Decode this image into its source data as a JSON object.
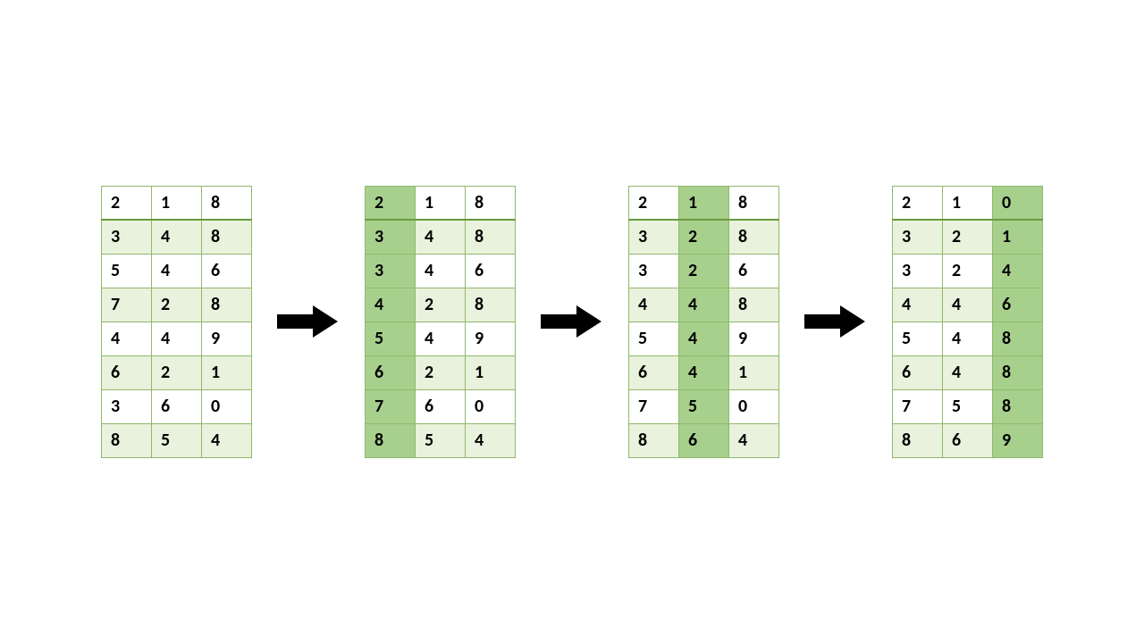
{
  "tables": [
    {
      "highlightCol": null,
      "rows": [
        [
          2,
          1,
          8
        ],
        [
          3,
          4,
          8
        ],
        [
          5,
          4,
          6
        ],
        [
          7,
          2,
          8
        ],
        [
          4,
          4,
          9
        ],
        [
          6,
          2,
          1
        ],
        [
          3,
          6,
          0
        ],
        [
          8,
          5,
          4
        ]
      ]
    },
    {
      "highlightCol": 0,
      "rows": [
        [
          2,
          1,
          8
        ],
        [
          3,
          4,
          8
        ],
        [
          3,
          4,
          6
        ],
        [
          4,
          2,
          8
        ],
        [
          5,
          4,
          9
        ],
        [
          6,
          2,
          1
        ],
        [
          7,
          6,
          0
        ],
        [
          8,
          5,
          4
        ]
      ]
    },
    {
      "highlightCol": 1,
      "rows": [
        [
          2,
          1,
          8
        ],
        [
          3,
          2,
          8
        ],
        [
          3,
          2,
          6
        ],
        [
          4,
          4,
          8
        ],
        [
          5,
          4,
          9
        ],
        [
          6,
          4,
          1
        ],
        [
          7,
          5,
          0
        ],
        [
          8,
          6,
          4
        ]
      ]
    },
    {
      "highlightCol": 2,
      "rows": [
        [
          2,
          1,
          0
        ],
        [
          3,
          2,
          1
        ],
        [
          3,
          2,
          4
        ],
        [
          4,
          4,
          6
        ],
        [
          5,
          4,
          8
        ],
        [
          6,
          4,
          8
        ],
        [
          7,
          5,
          8
        ],
        [
          8,
          6,
          9
        ]
      ]
    }
  ],
  "chart_data": {
    "type": "table",
    "description": "Four 8x3 tables showing sequential column-wise sorting steps, connected by right arrows. Highlighted column indicates which column was just sorted.",
    "steps": [
      {
        "step": 0,
        "sortedColumn": null,
        "data": [
          [
            2,
            1,
            8
          ],
          [
            3,
            4,
            8
          ],
          [
            5,
            4,
            6
          ],
          [
            7,
            2,
            8
          ],
          [
            4,
            4,
            9
          ],
          [
            6,
            2,
            1
          ],
          [
            3,
            6,
            0
          ],
          [
            8,
            5,
            4
          ]
        ]
      },
      {
        "step": 1,
        "sortedColumn": 0,
        "data": [
          [
            2,
            1,
            8
          ],
          [
            3,
            4,
            8
          ],
          [
            3,
            4,
            6
          ],
          [
            4,
            2,
            8
          ],
          [
            5,
            4,
            9
          ],
          [
            6,
            2,
            1
          ],
          [
            7,
            6,
            0
          ],
          [
            8,
            5,
            4
          ]
        ]
      },
      {
        "step": 2,
        "sortedColumn": 1,
        "data": [
          [
            2,
            1,
            8
          ],
          [
            3,
            2,
            8
          ],
          [
            3,
            2,
            6
          ],
          [
            4,
            4,
            8
          ],
          [
            5,
            4,
            9
          ],
          [
            6,
            4,
            1
          ],
          [
            7,
            5,
            0
          ],
          [
            8,
            6,
            4
          ]
        ]
      },
      {
        "step": 3,
        "sortedColumn": 2,
        "data": [
          [
            2,
            1,
            0
          ],
          [
            3,
            2,
            1
          ],
          [
            3,
            2,
            4
          ],
          [
            4,
            4,
            6
          ],
          [
            5,
            4,
            8
          ],
          [
            6,
            4,
            8
          ],
          [
            7,
            5,
            8
          ],
          [
            8,
            6,
            9
          ]
        ]
      }
    ]
  }
}
